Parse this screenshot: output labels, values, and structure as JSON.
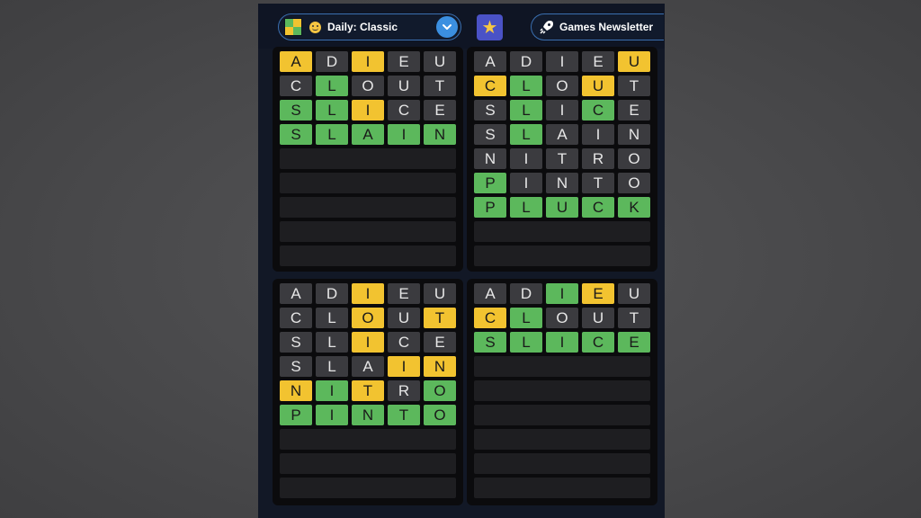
{
  "header": {
    "mode_label": "Daily: Classic",
    "newsletter_label": "Games Newsletter"
  },
  "colors": {
    "correct": "#5cb85c",
    "present": "#f2c330",
    "absent": "#3b3b3f",
    "empty": "#1e1e21",
    "accent": "#3b8fe0"
  },
  "boards": [
    {
      "name": "board-top-left",
      "guesses": [
        {
          "word": [
            "A",
            "D",
            "I",
            "E",
            "U"
          ],
          "states": [
            "present",
            "absent",
            "present",
            "absent",
            "absent"
          ]
        },
        {
          "word": [
            "C",
            "L",
            "O",
            "U",
            "T"
          ],
          "states": [
            "absent",
            "correct",
            "absent",
            "absent",
            "absent"
          ]
        },
        {
          "word": [
            "S",
            "L",
            "I",
            "C",
            "E"
          ],
          "states": [
            "correct",
            "correct",
            "present",
            "absent",
            "absent"
          ]
        },
        {
          "word": [
            "S",
            "L",
            "A",
            "I",
            "N"
          ],
          "states": [
            "correct",
            "correct",
            "correct",
            "correct",
            "correct"
          ]
        }
      ],
      "empty_rows": 5
    },
    {
      "name": "board-top-right",
      "guesses": [
        {
          "word": [
            "A",
            "D",
            "I",
            "E",
            "U"
          ],
          "states": [
            "absent",
            "absent",
            "absent",
            "absent",
            "present"
          ]
        },
        {
          "word": [
            "C",
            "L",
            "O",
            "U",
            "T"
          ],
          "states": [
            "present",
            "correct",
            "absent",
            "present",
            "absent"
          ]
        },
        {
          "word": [
            "S",
            "L",
            "I",
            "C",
            "E"
          ],
          "states": [
            "absent",
            "correct",
            "absent",
            "correct",
            "absent"
          ]
        },
        {
          "word": [
            "S",
            "L",
            "A",
            "I",
            "N"
          ],
          "states": [
            "absent",
            "correct",
            "absent",
            "absent",
            "absent"
          ]
        },
        {
          "word": [
            "N",
            "I",
            "T",
            "R",
            "O"
          ],
          "states": [
            "absent",
            "absent",
            "absent",
            "absent",
            "absent"
          ]
        },
        {
          "word": [
            "P",
            "I",
            "N",
            "T",
            "O"
          ],
          "states": [
            "correct",
            "absent",
            "absent",
            "absent",
            "absent"
          ]
        },
        {
          "word": [
            "P",
            "L",
            "U",
            "C",
            "K"
          ],
          "states": [
            "correct",
            "correct",
            "correct",
            "correct",
            "correct"
          ]
        }
      ],
      "empty_rows": 2
    },
    {
      "name": "board-bottom-left",
      "guesses": [
        {
          "word": [
            "A",
            "D",
            "I",
            "E",
            "U"
          ],
          "states": [
            "absent",
            "absent",
            "present",
            "absent",
            "absent"
          ]
        },
        {
          "word": [
            "C",
            "L",
            "O",
            "U",
            "T"
          ],
          "states": [
            "absent",
            "absent",
            "present",
            "absent",
            "present"
          ]
        },
        {
          "word": [
            "S",
            "L",
            "I",
            "C",
            "E"
          ],
          "states": [
            "absent",
            "absent",
            "present",
            "absent",
            "absent"
          ]
        },
        {
          "word": [
            "S",
            "L",
            "A",
            "I",
            "N"
          ],
          "states": [
            "absent",
            "absent",
            "absent",
            "present",
            "present"
          ]
        },
        {
          "word": [
            "N",
            "I",
            "T",
            "R",
            "O"
          ],
          "states": [
            "present",
            "correct",
            "present",
            "absent",
            "correct"
          ]
        },
        {
          "word": [
            "P",
            "I",
            "N",
            "T",
            "O"
          ],
          "states": [
            "correct",
            "correct",
            "correct",
            "correct",
            "correct"
          ]
        }
      ],
      "empty_rows": 3
    },
    {
      "name": "board-bottom-right",
      "guesses": [
        {
          "word": [
            "A",
            "D",
            "I",
            "E",
            "U"
          ],
          "states": [
            "absent",
            "absent",
            "correct",
            "present",
            "absent"
          ]
        },
        {
          "word": [
            "C",
            "L",
            "O",
            "U",
            "T"
          ],
          "states": [
            "present",
            "correct",
            "absent",
            "absent",
            "absent"
          ]
        },
        {
          "word": [
            "S",
            "L",
            "I",
            "C",
            "E"
          ],
          "states": [
            "correct",
            "correct",
            "correct",
            "correct",
            "correct"
          ]
        }
      ],
      "empty_rows": 6
    }
  ]
}
